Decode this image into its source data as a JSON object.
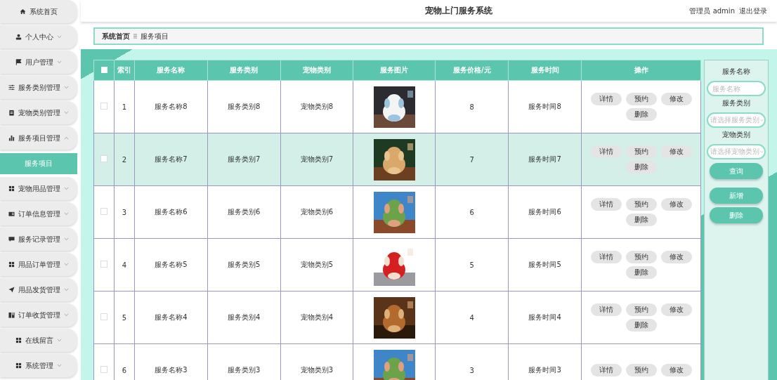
{
  "header": {
    "title": "宠物上门服务系统",
    "user": "管理员 admin",
    "logout": "退出登录"
  },
  "sidebar": {
    "items": [
      {
        "label": "系统首页"
      },
      {
        "label": "个人中心",
        "expanded": false
      },
      {
        "label": "用户管理",
        "expanded": false
      },
      {
        "label": "服务类别管理",
        "expanded": false
      },
      {
        "label": "宠物类别管理",
        "expanded": false
      },
      {
        "label": "服务项目管理",
        "expanded": true,
        "children": [
          {
            "label": "服务项目",
            "selected": true
          }
        ]
      },
      {
        "label": "宠物用品管理",
        "expanded": false
      },
      {
        "label": "订单信息管理",
        "expanded": false
      },
      {
        "label": "服务记录管理",
        "expanded": false
      },
      {
        "label": "用品订单管理",
        "expanded": false
      },
      {
        "label": "用品发货管理",
        "expanded": false
      },
      {
        "label": "订单收货管理",
        "expanded": false
      },
      {
        "label": "在线留言",
        "expanded": false
      },
      {
        "label": "系统管理",
        "expanded": false
      }
    ]
  },
  "breadcrumb": {
    "items": [
      "系统首页",
      "服务项目"
    ]
  },
  "table": {
    "select_all_checked": false,
    "columns": [
      "索引",
      "服务名称",
      "服务类别",
      "宠物类别",
      "服务图片",
      "服务价格/元",
      "服务时间",
      "操作"
    ],
    "rows": [
      {
        "checked": false,
        "selected": false,
        "index": "1",
        "name": "服务名称8",
        "service_type": "服务类别8",
        "pet_type": "宠物类别8",
        "picture": {
          "kind": "picture"
        },
        "price": "8",
        "time": "服务时间8",
        "actions": [
          "详情",
          "预约",
          "修改",
          "删除"
        ]
      },
      {
        "checked": false,
        "selected": true,
        "index": "2",
        "name": "服务名称7",
        "service_type": "服务类别7",
        "pet_type": "宠物类别7",
        "picture": {
          "kind": "picture"
        },
        "price": "7",
        "time": "服务时间7",
        "actions": [
          "详情",
          "预约",
          "修改",
          "删除"
        ]
      },
      {
        "checked": false,
        "selected": false,
        "index": "3",
        "name": "服务名称6",
        "service_type": "服务类别6",
        "pet_type": "宠物类别6",
        "picture": {
          "kind": "picture"
        },
        "price": "6",
        "time": "服务时间6",
        "actions": [
          "详情",
          "预约",
          "修改",
          "删除"
        ]
      },
      {
        "checked": false,
        "selected": false,
        "index": "4",
        "name": "服务名称5",
        "service_type": "服务类别5",
        "pet_type": "宠物类别5",
        "picture": {
          "kind": "picture"
        },
        "price": "5",
        "time": "服务时间5",
        "actions": [
          "详情",
          "预约",
          "修改",
          "删除"
        ]
      },
      {
        "checked": false,
        "selected": false,
        "index": "5",
        "name": "服务名称4",
        "service_type": "服务类别4",
        "pet_type": "宠物类别4",
        "picture": {
          "kind": "picture"
        },
        "price": "4",
        "time": "服务时间4",
        "actions": [
          "详情",
          "预约",
          "修改",
          "删除"
        ]
      },
      {
        "checked": false,
        "selected": false,
        "index": "6",
        "name": "服务名称3",
        "service_type": "服务类别3",
        "pet_type": "宠物类别3",
        "picture": {
          "kind": "picture"
        },
        "price": "3",
        "time": "服务时间3",
        "actions": [
          "详情",
          "预约",
          "修改"
        ]
      }
    ]
  },
  "search_panel": {
    "fields": [
      {
        "label": "服务名称",
        "kind": "text",
        "placeholder": "服务名称"
      },
      {
        "label": "服务类别",
        "kind": "select",
        "placeholder": "请选择服务类别"
      },
      {
        "label": "宠物类别",
        "kind": "select",
        "placeholder": "请选择宠物类别"
      }
    ],
    "buttons": [
      "查询",
      "新增",
      "删除"
    ]
  }
}
